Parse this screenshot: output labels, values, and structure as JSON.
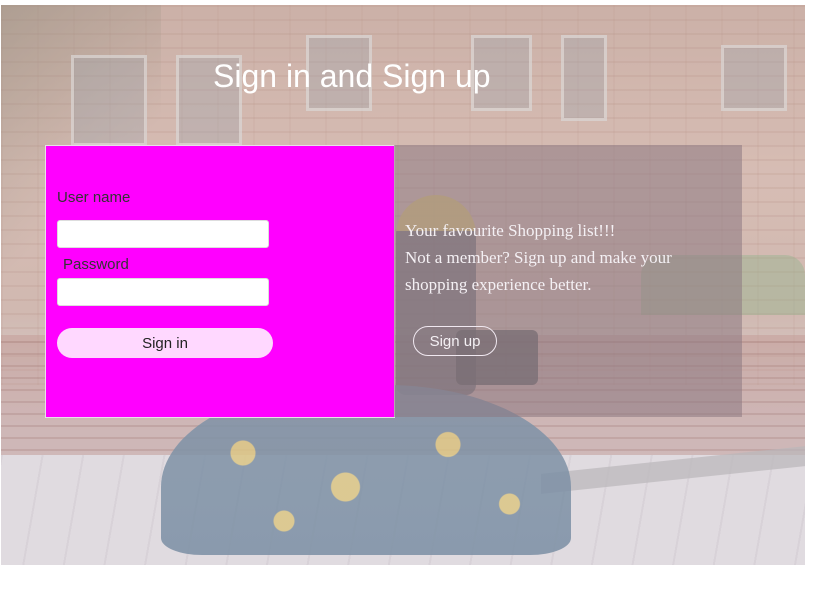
{
  "header": {
    "title": "Sign in and Sign up"
  },
  "signin": {
    "username_label": "User name",
    "username_value": "",
    "password_label": "Password",
    "password_value": "",
    "button_label": "Sign in"
  },
  "signup": {
    "promo_line1": "Your favourite Shopping list!!!",
    "promo_line2": "Not a member? Sign up and make your",
    "promo_line3": "shopping experience better.",
    "button_label": "Sign up"
  },
  "colors": {
    "signin_panel_bg": "#ff00ff",
    "signin_button_bg": "#ffd8ff",
    "title_color": "#ffffff"
  }
}
